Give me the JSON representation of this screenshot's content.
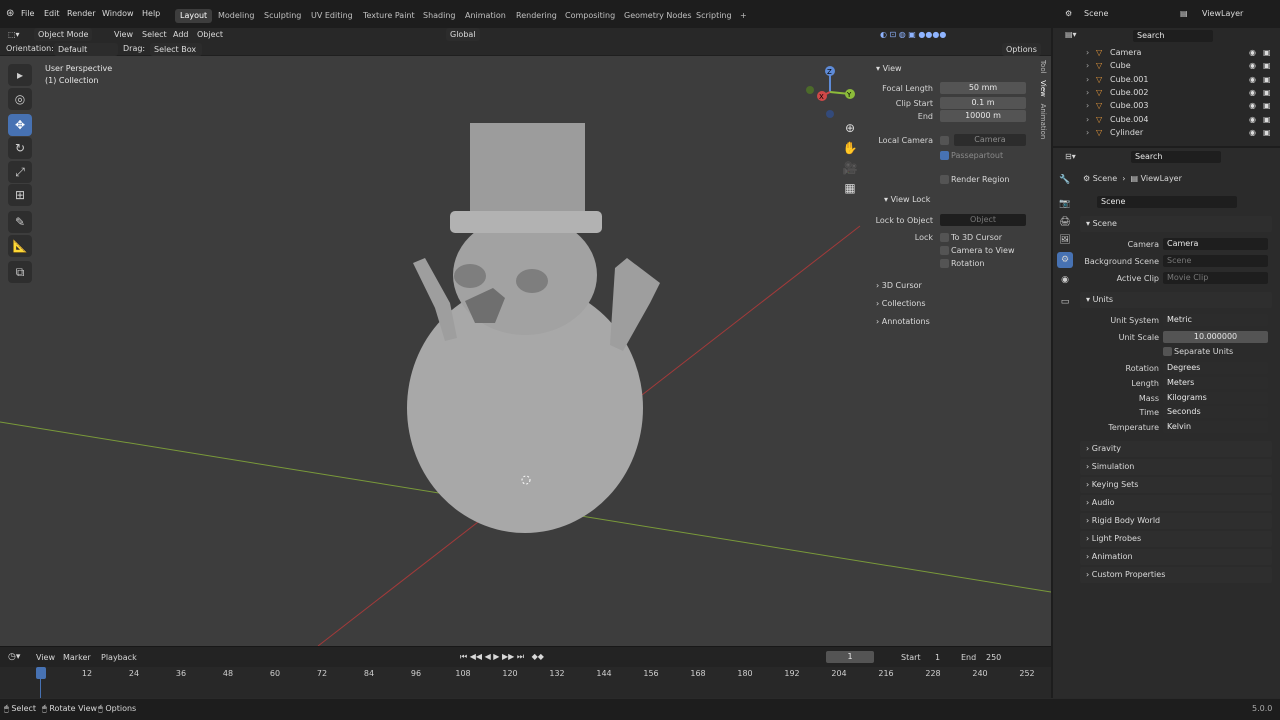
{
  "top_menu": {
    "file": "File",
    "edit": "Edit",
    "render": "Render",
    "window": "Window",
    "help": "Help"
  },
  "workspaces": [
    "Layout",
    "Modeling",
    "Sculpting",
    "UV Editing",
    "Texture Paint",
    "Shading",
    "Animation",
    "Rendering",
    "Compositing",
    "Geometry Nodes",
    "Scripting"
  ],
  "scene": {
    "name": "Scene",
    "view_layer": "ViewLayer"
  },
  "viewport": {
    "mode": "Object Mode",
    "view": "View",
    "select": "Select",
    "add": "Add",
    "object": "Object",
    "orientation_label": "Orientation:",
    "orientation": "Default",
    "drag_label": "Drag:",
    "drag": "Select Box",
    "transform": "Global",
    "options": "Options",
    "perspective": "User Perspective",
    "collection": "(1) Collection",
    "gizmo": {
      "z": "Z",
      "x": "X",
      "y": "Y"
    }
  },
  "npanel": {
    "view_title": "View",
    "focal_length_label": "Focal Length",
    "focal_length": "50 mm",
    "clip_start_label": "Clip Start",
    "clip_start": "0.1 m",
    "end_label": "End",
    "clip_end": "10000 m",
    "local_camera_label": "Local Camera",
    "local_camera": "Camera",
    "passepartout": "Passepartout",
    "render_region": "Render Region",
    "view_lock_title": "View Lock",
    "lock_to_object_label": "Lock to Object",
    "lock_to_object": "Object",
    "lock_label": "Lock",
    "to_3d_cursor": "To 3D Cursor",
    "camera_to_view": "Camera to View",
    "rotation": "Rotation",
    "cursor_3d": "3D Cursor",
    "collections": "Collections",
    "annotations": "Annotations",
    "tabs": [
      "Tool",
      "View",
      "Animation"
    ]
  },
  "timeline": {
    "view": "View",
    "marker": "Marker",
    "playback": "Playback",
    "frame": "1",
    "start_label": "Start",
    "start": "1",
    "end_label": "End",
    "end": "250",
    "ticks": [
      "0",
      "12",
      "24",
      "36",
      "48",
      "60",
      "72",
      "84",
      "96",
      "108",
      "120",
      "132",
      "144",
      "156",
      "168",
      "180",
      "192",
      "204",
      "216",
      "228",
      "240",
      "252"
    ]
  },
  "status": {
    "select": "Select",
    "rotate": "Rotate View",
    "options": "Options",
    "version": "5.0.0"
  },
  "outliner": {
    "search": "Search",
    "items": [
      "Camera",
      "Cube",
      "Cube.001",
      "Cube.002",
      "Cube.003",
      "Cube.004",
      "Cylinder"
    ]
  },
  "properties": {
    "search": "Search",
    "breadcrumb_scene": "Scene",
    "breadcrumb_layer": "ViewLayer",
    "scene_name": "Scene",
    "scene_section": "Scene",
    "camera_label": "Camera",
    "camera": "Camera",
    "bg_scene_label": "Background Scene",
    "bg_scene": "Scene",
    "active_clip_label": "Active Clip",
    "active_clip": "Movie Clip",
    "units_section": "Units",
    "unit_system_label": "Unit System",
    "unit_system": "Metric",
    "unit_scale_label": "Unit Scale",
    "unit_scale": "10.000000",
    "separate_units": "Separate Units",
    "rotation_label": "Rotation",
    "rotation": "Degrees",
    "length_label": "Length",
    "length": "Meters",
    "mass_label": "Mass",
    "mass": "Kilograms",
    "time_label": "Time",
    "time": "Seconds",
    "temperature_label": "Temperature",
    "temperature": "Kelvin",
    "sections": [
      "Gravity",
      "Simulation",
      "Keying Sets",
      "Audio",
      "Rigid Body World",
      "Light Probes",
      "Animation",
      "Custom Properties"
    ]
  },
  "colors": {
    "accent": "#4772b3",
    "object_orange": "#e89a3c",
    "mesh_green": "#5fc08a"
  }
}
